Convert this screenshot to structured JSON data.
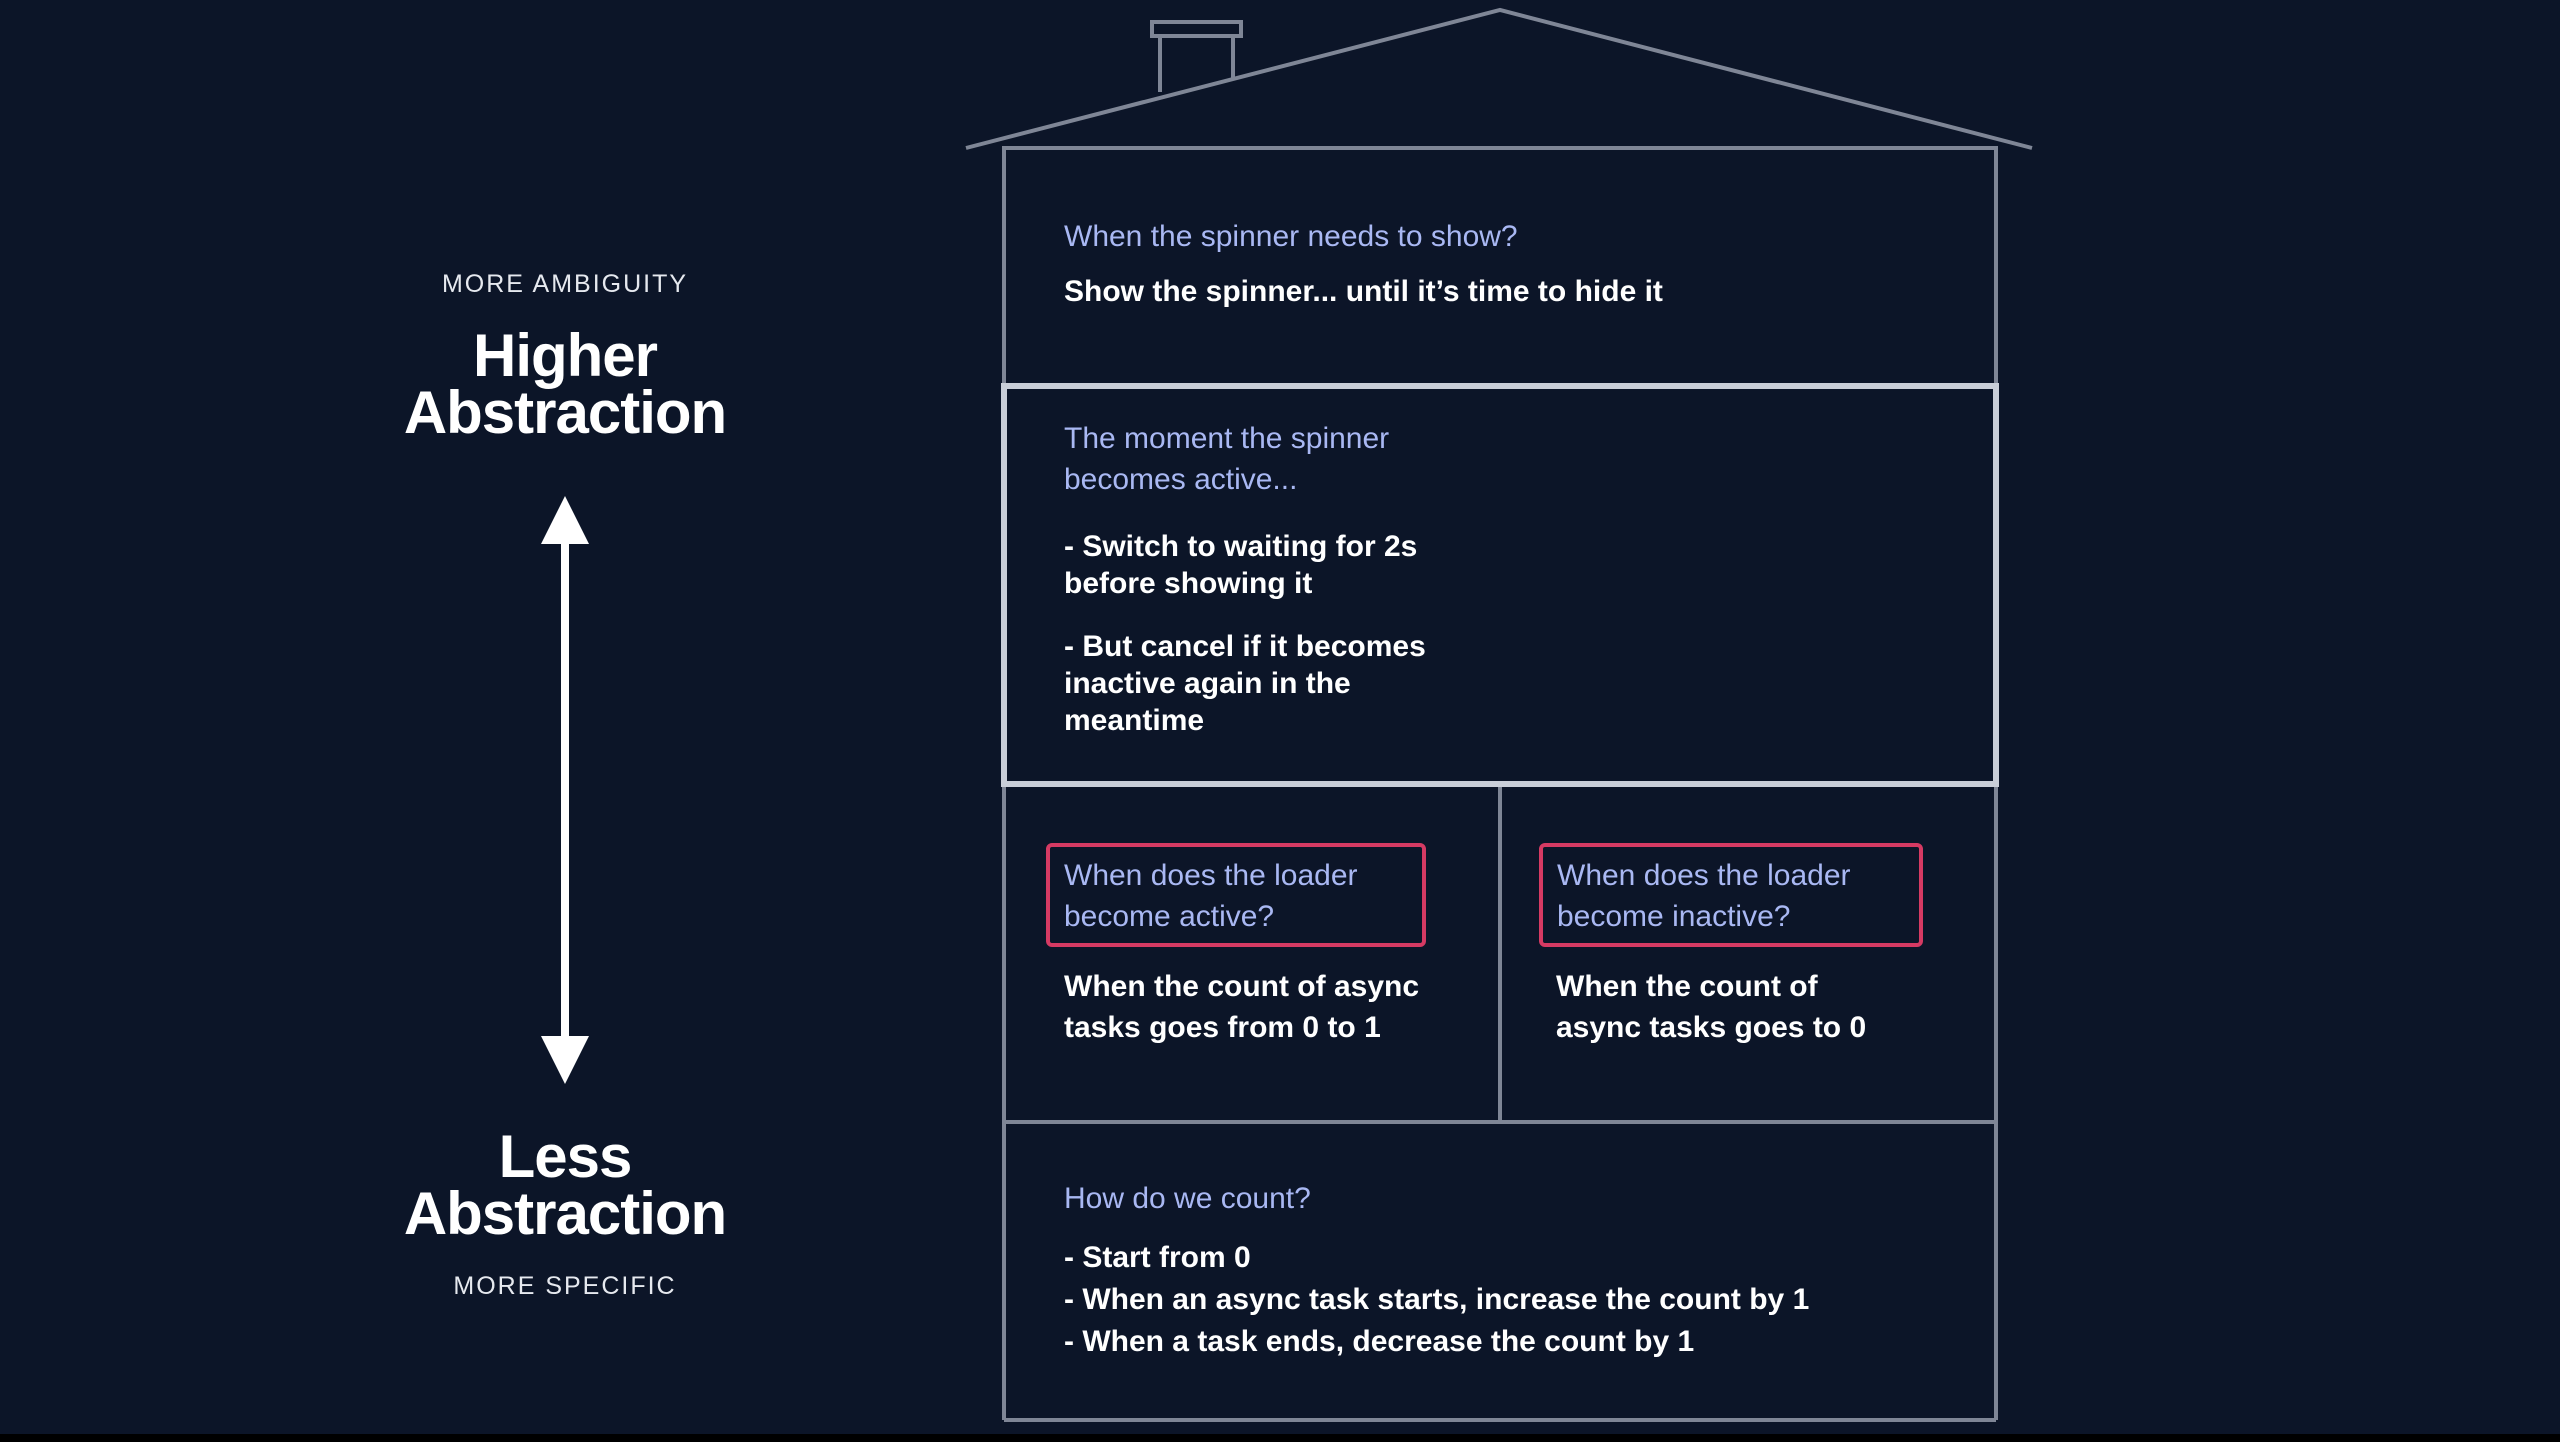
{
  "scale": {
    "top_caption": "MORE AMBIGUITY",
    "top_title_line1": "Higher",
    "top_title_line2": "Abstraction",
    "bottom_title_line1": "Less",
    "bottom_title_line2": "Abstraction",
    "bottom_caption": "MORE SPECIFIC"
  },
  "rooms": {
    "top": {
      "question": "When the spinner needs to show?",
      "answer": "Show the spinner... until it’s time to hide it"
    },
    "middle": {
      "question_line1": "The moment the spinner",
      "question_line2": "becomes active...",
      "point1_line1": "- Switch to waiting for 2s",
      "point1_line2": "before showing it",
      "point2_line1": "- But cancel if it becomes",
      "point2_line2": "inactive again in the",
      "point2_line3": "meantime"
    },
    "left": {
      "question_line1": "When does the loader",
      "question_line2": "become active?",
      "answer_line1": "When the count of async",
      "answer_line2": "tasks goes from 0 to 1"
    },
    "right": {
      "question_line1": "When does the loader",
      "question_line2": "become inactive?",
      "answer_line1": "When the count of",
      "answer_line2": "async tasks goes to 0"
    },
    "bottom": {
      "question": "How do we count?",
      "items": [
        "- Start from 0",
        "- When an async task starts, increase the count by 1",
        "- When a task ends, decrease the count by 1"
      ]
    }
  },
  "colors": {
    "background": "#0c1528",
    "outline": "#7f8696",
    "highlight_outline": "#c9ced8",
    "question_text": "#a9b8f3",
    "answer_text": "#ffffff",
    "callout_border": "#d63a63"
  }
}
